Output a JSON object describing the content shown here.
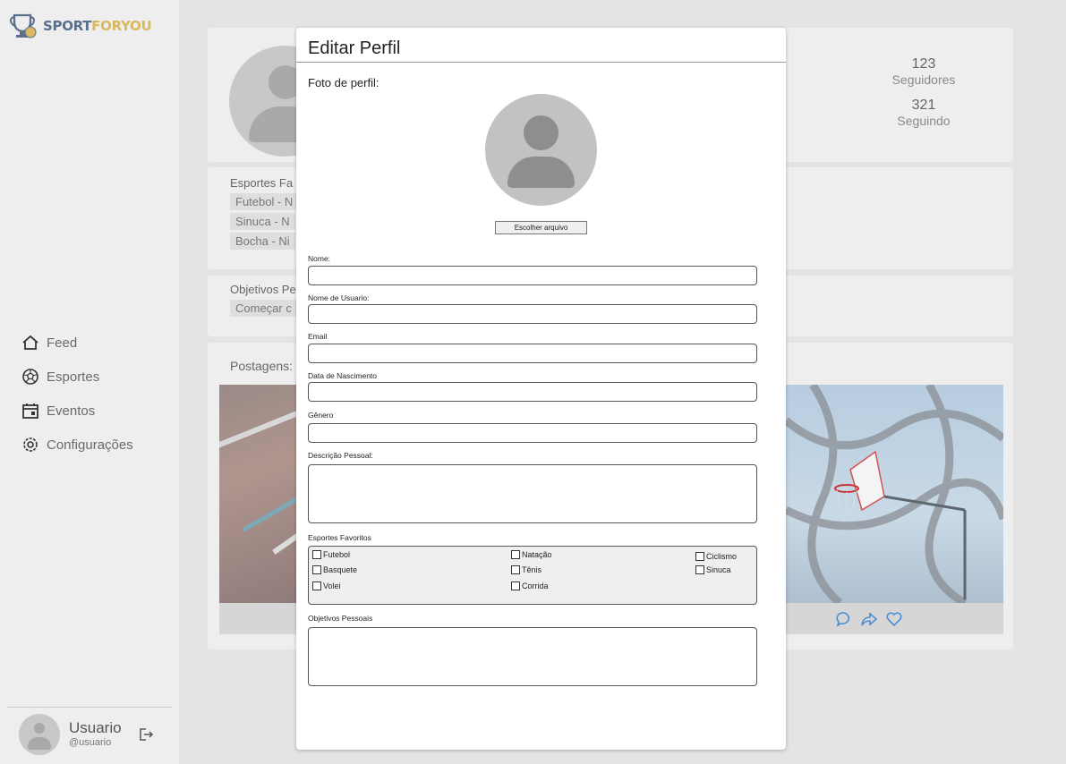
{
  "brand": {
    "part1": "SPORT",
    "part2": "FORYOU"
  },
  "nav": [
    {
      "label": "Feed",
      "icon": "home-icon"
    },
    {
      "label": "Esportes",
      "icon": "ball-icon"
    },
    {
      "label": "Eventos",
      "icon": "calendar-icon"
    },
    {
      "label": "Configurações",
      "icon": "gear-icon"
    }
  ],
  "user": {
    "name": "Usuario",
    "handle": "@usuario"
  },
  "profile": {
    "followers": "123",
    "followers_label": "Seguidores",
    "following": "321",
    "following_label": "Seguindo"
  },
  "sports_section": {
    "title": "Esportes Fa",
    "chips": [
      "Futebol - N",
      "Sinuca - N",
      "Bocha - Ni"
    ]
  },
  "goals_section": {
    "title": "Objetivos Pe",
    "chip": "Começar c"
  },
  "posts_section": {
    "title": "Postagens:"
  },
  "modal": {
    "title": "Editar Perfil",
    "photo_label": "Foto de perfil:",
    "file_button": "Escolher arquivo",
    "fields": {
      "name": {
        "label": "Nome:",
        "value": ""
      },
      "username": {
        "label": "Nome de Usuario:",
        "value": ""
      },
      "email": {
        "label": "Email",
        "value": ""
      },
      "birthdate": {
        "label": "Data de Nascimento",
        "value": ""
      },
      "gender": {
        "label": "Gênero",
        "value": ""
      },
      "description": {
        "label": "Descrição Pessoal:",
        "value": ""
      },
      "fav_sports": {
        "label": "Esportes Favoritos"
      },
      "goals": {
        "label": "Objetivos Pessoais",
        "value": ""
      }
    },
    "sports_options": {
      "futebol": "Futebol",
      "natacao": "Natação",
      "ciclismo": "Ciclismo",
      "basquete": "Basquete",
      "tenis": "Tênis",
      "sinuca": "Sinuca",
      "volei": "Volei",
      "corrida": "Corrida"
    }
  },
  "colors": {
    "accent_icon": "#4a8fd6",
    "brand_blue": "#5a6f8c",
    "brand_gold": "#d9b860"
  }
}
